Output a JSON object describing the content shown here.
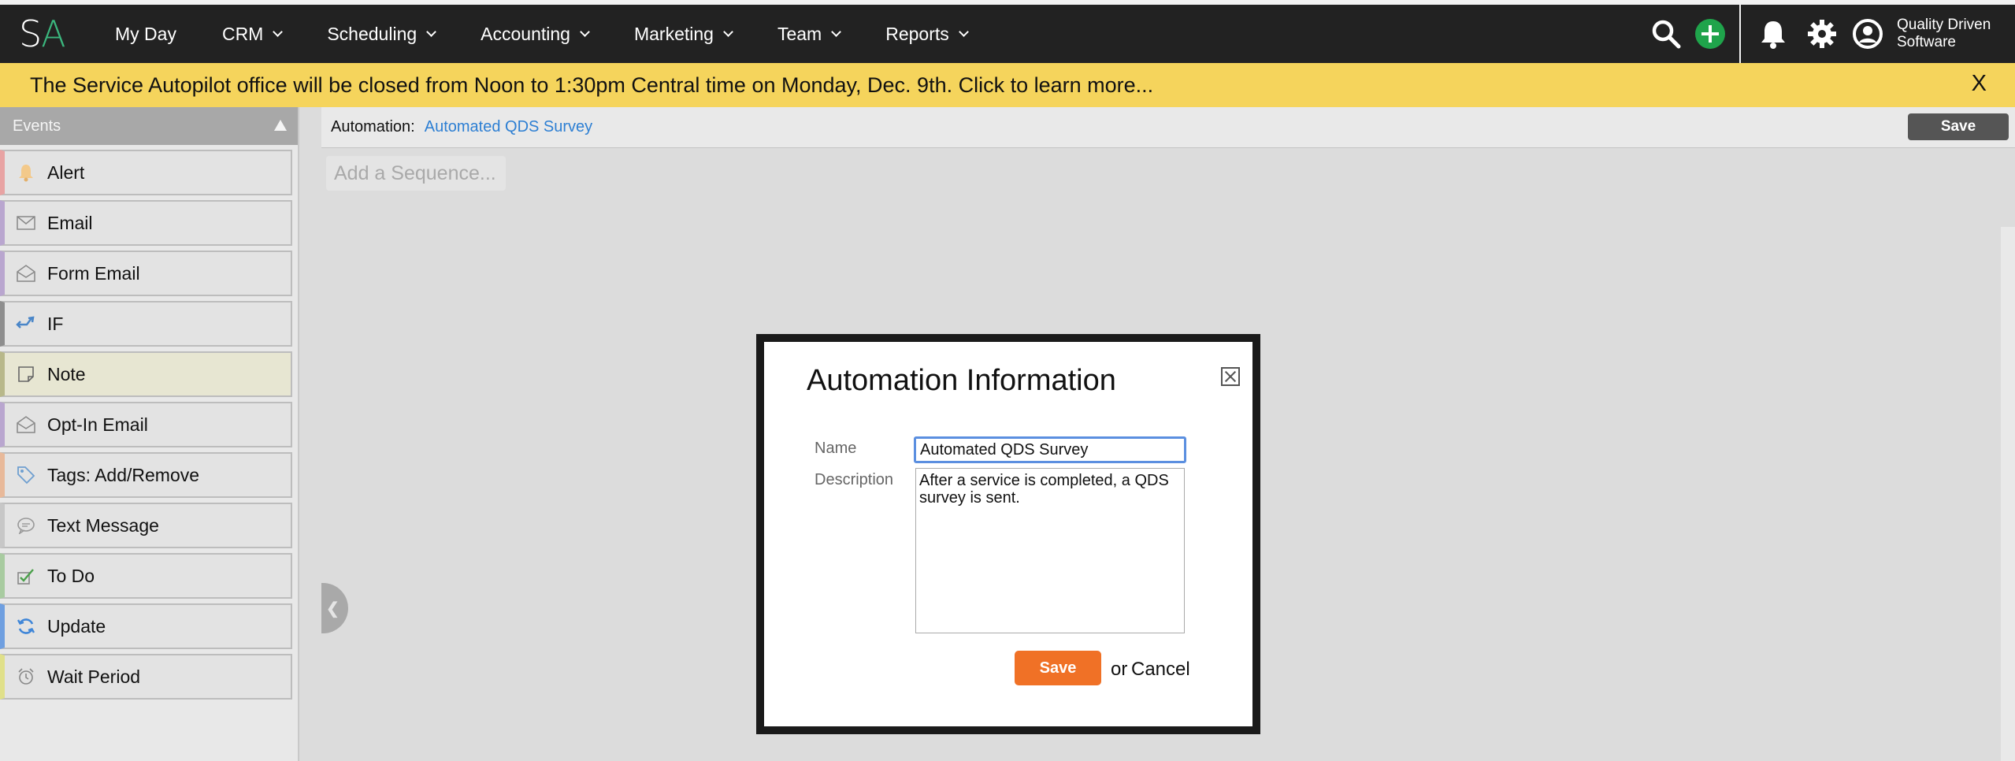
{
  "header": {
    "logo_s": "S",
    "logo_a": "A",
    "nav": [
      {
        "label": "My Day",
        "has_dropdown": false
      },
      {
        "label": "CRM",
        "has_dropdown": true
      },
      {
        "label": "Scheduling",
        "has_dropdown": true
      },
      {
        "label": "Accounting",
        "has_dropdown": true
      },
      {
        "label": "Marketing",
        "has_dropdown": true
      },
      {
        "label": "Team",
        "has_dropdown": true
      },
      {
        "label": "Reports",
        "has_dropdown": true
      }
    ],
    "icons": [
      "search-icon",
      "add-icon",
      "bell-icon",
      "gear-icon",
      "user-icon"
    ],
    "user_line1": "Quality Driven",
    "user_line2": "Software",
    "accent_add_color": "#1fa44b"
  },
  "banner": {
    "text": "The Service Autopilot office will be closed from Noon to 1:30pm Central time on Monday, Dec. 9th. Click to learn more...",
    "close_label": "X",
    "color": "#f5d45c"
  },
  "sidebar": {
    "title": "Events",
    "items": [
      {
        "label": "Alert",
        "icon": "bell-icon",
        "color": "#e8a3a3"
      },
      {
        "label": "Email",
        "icon": "envelope-icon",
        "color": "#b9a6cf"
      },
      {
        "label": "Form Email",
        "icon": "open-envelope-icon",
        "color": "#b9a6cf"
      },
      {
        "label": "IF",
        "icon": "branch-arrow-icon",
        "color": "#8e8e8e"
      },
      {
        "label": "Note",
        "icon": "note-icon",
        "color": "#b8b88a"
      },
      {
        "label": "Opt-In Email",
        "icon": "open-envelope-icon",
        "color": "#b9a6cf"
      },
      {
        "label": "Tags: Add/Remove",
        "icon": "tag-icon",
        "color": "#e8b99a"
      },
      {
        "label": "Text Message",
        "icon": "chat-bubble-icon",
        "color": "#c7c7c7"
      },
      {
        "label": "To Do",
        "icon": "checkbox-icon",
        "color": "#a8cba0"
      },
      {
        "label": "Update",
        "icon": "refresh-icon",
        "color": "#6f9fe0"
      },
      {
        "label": "Wait Period",
        "icon": "alarm-clock-icon",
        "color": "#e0e08a"
      }
    ]
  },
  "main": {
    "breadcrumb_label": "Automation:",
    "breadcrumb_link": "Automated QDS Survey",
    "save_label": "Save",
    "add_sequence_placeholder": "Add a Sequence..."
  },
  "modal": {
    "title": "Automation Information",
    "name_label": "Name",
    "name_value": "Automated QDS Survey",
    "description_label": "Description",
    "description_value": "After a service is completed, a QDS survey is sent.",
    "save_label": "Save",
    "or_text": "or",
    "cancel_label": "Cancel",
    "save_color": "#f07126"
  }
}
